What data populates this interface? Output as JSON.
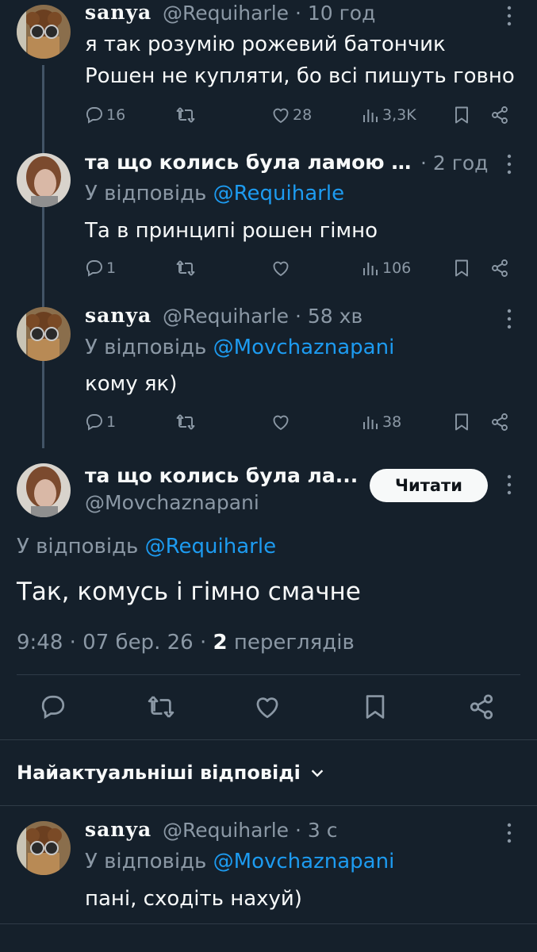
{
  "tweets": [
    {
      "name": "sanya",
      "handle_time": "@Requiharle · 10 год",
      "line1": "я так розумію рожевий батончик",
      "line2": "Рошен не купляти, бо всі пишуть говно",
      "replies": "16",
      "likes": "28",
      "views": "3,3K"
    },
    {
      "name": "та що колись була ламою …",
      "time": "· 2 год",
      "reply_prefix": "У відповідь ",
      "reply_to": "@Requiharle",
      "text": "Та в принципі рошен гімно",
      "replies": "1",
      "views": "106"
    },
    {
      "name": "sanya",
      "handle_time": "@Requiharle · 58 хв",
      "reply_prefix": "У відповідь ",
      "reply_to": "@Movchaznapani",
      "text": "кому як)",
      "replies": "1",
      "views": "38"
    }
  ],
  "main_tweet": {
    "name": "та що колись була ла...",
    "handle": "@Movchaznapani",
    "follow_button": "Читати",
    "reply_prefix": "У відповідь ",
    "reply_to": "@Requiharle",
    "text": "Так, комусь і гімно смачне",
    "meta_time": "9:48 · 07 бер. 26 · ",
    "views_count": "2",
    "views_label": " переглядів"
  },
  "sort_label": "Найактуальніші відповіді",
  "bottom_reply": {
    "name": "sanya",
    "handle_time": "@Requiharle · 3 с",
    "reply_prefix": "У відповідь ",
    "reply_to": "@Movchaznapani",
    "text": "пані, сходіть нахуй)"
  },
  "colors": {
    "background": "#15202b",
    "accent": "#1d9bf0",
    "muted": "#8b98a5",
    "text": "#f7f9f9"
  }
}
